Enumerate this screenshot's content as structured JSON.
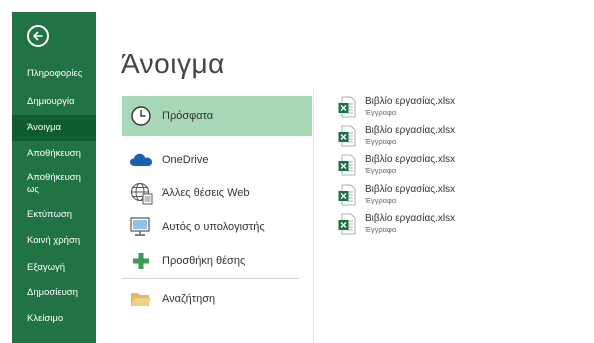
{
  "sidebar": {
    "items": [
      {
        "label": "Πληροφορίες"
      },
      {
        "label": "Δημιουργία"
      },
      {
        "label": "Άνοιγμα",
        "active": true
      },
      {
        "label": "Αποθήκευση"
      },
      {
        "label": "Αποθήκευση ως"
      },
      {
        "label": "Εκτύπωση"
      },
      {
        "label": "Κοινή χρήση"
      },
      {
        "label": "Εξαγωγή"
      },
      {
        "label": "Δημοσίευση"
      },
      {
        "label": "Κλείσιμο"
      }
    ],
    "background_color": "#217346",
    "active_color": "#0e5c2f"
  },
  "main": {
    "title": "Άνοιγμα",
    "locations": [
      {
        "label": "Πρόσφατα",
        "icon": "clock-icon",
        "selected": true
      },
      {
        "label": "OneDrive",
        "icon": "cloud-icon"
      },
      {
        "label": "Άλλες θέσεις Web",
        "icon": "globe-icon"
      },
      {
        "label": "Αυτός ο υπολογιστής",
        "icon": "computer-icon"
      },
      {
        "label": "Προσθήκη θέσης",
        "icon": "plus-icon"
      },
      {
        "label": "Αναζήτηση",
        "icon": "folder-icon"
      }
    ],
    "selected_color": "#a9d8b8"
  },
  "recent_files": [
    {
      "name": "Βιβλίο εργασίας.xlsx",
      "location": "Έγγραφα"
    },
    {
      "name": "Βιβλίο εργασίας.xlsx",
      "location": "Έγγραφα"
    },
    {
      "name": "Βιβλίο εργασίας.xlsx",
      "location": "Έγγραφα"
    },
    {
      "name": "Βιβλίο εργασίας.xlsx",
      "location": "Έγγραφα"
    },
    {
      "name": "Βιβλίο εργασίας.xlsx",
      "location": "Έγγραφα"
    }
  ]
}
